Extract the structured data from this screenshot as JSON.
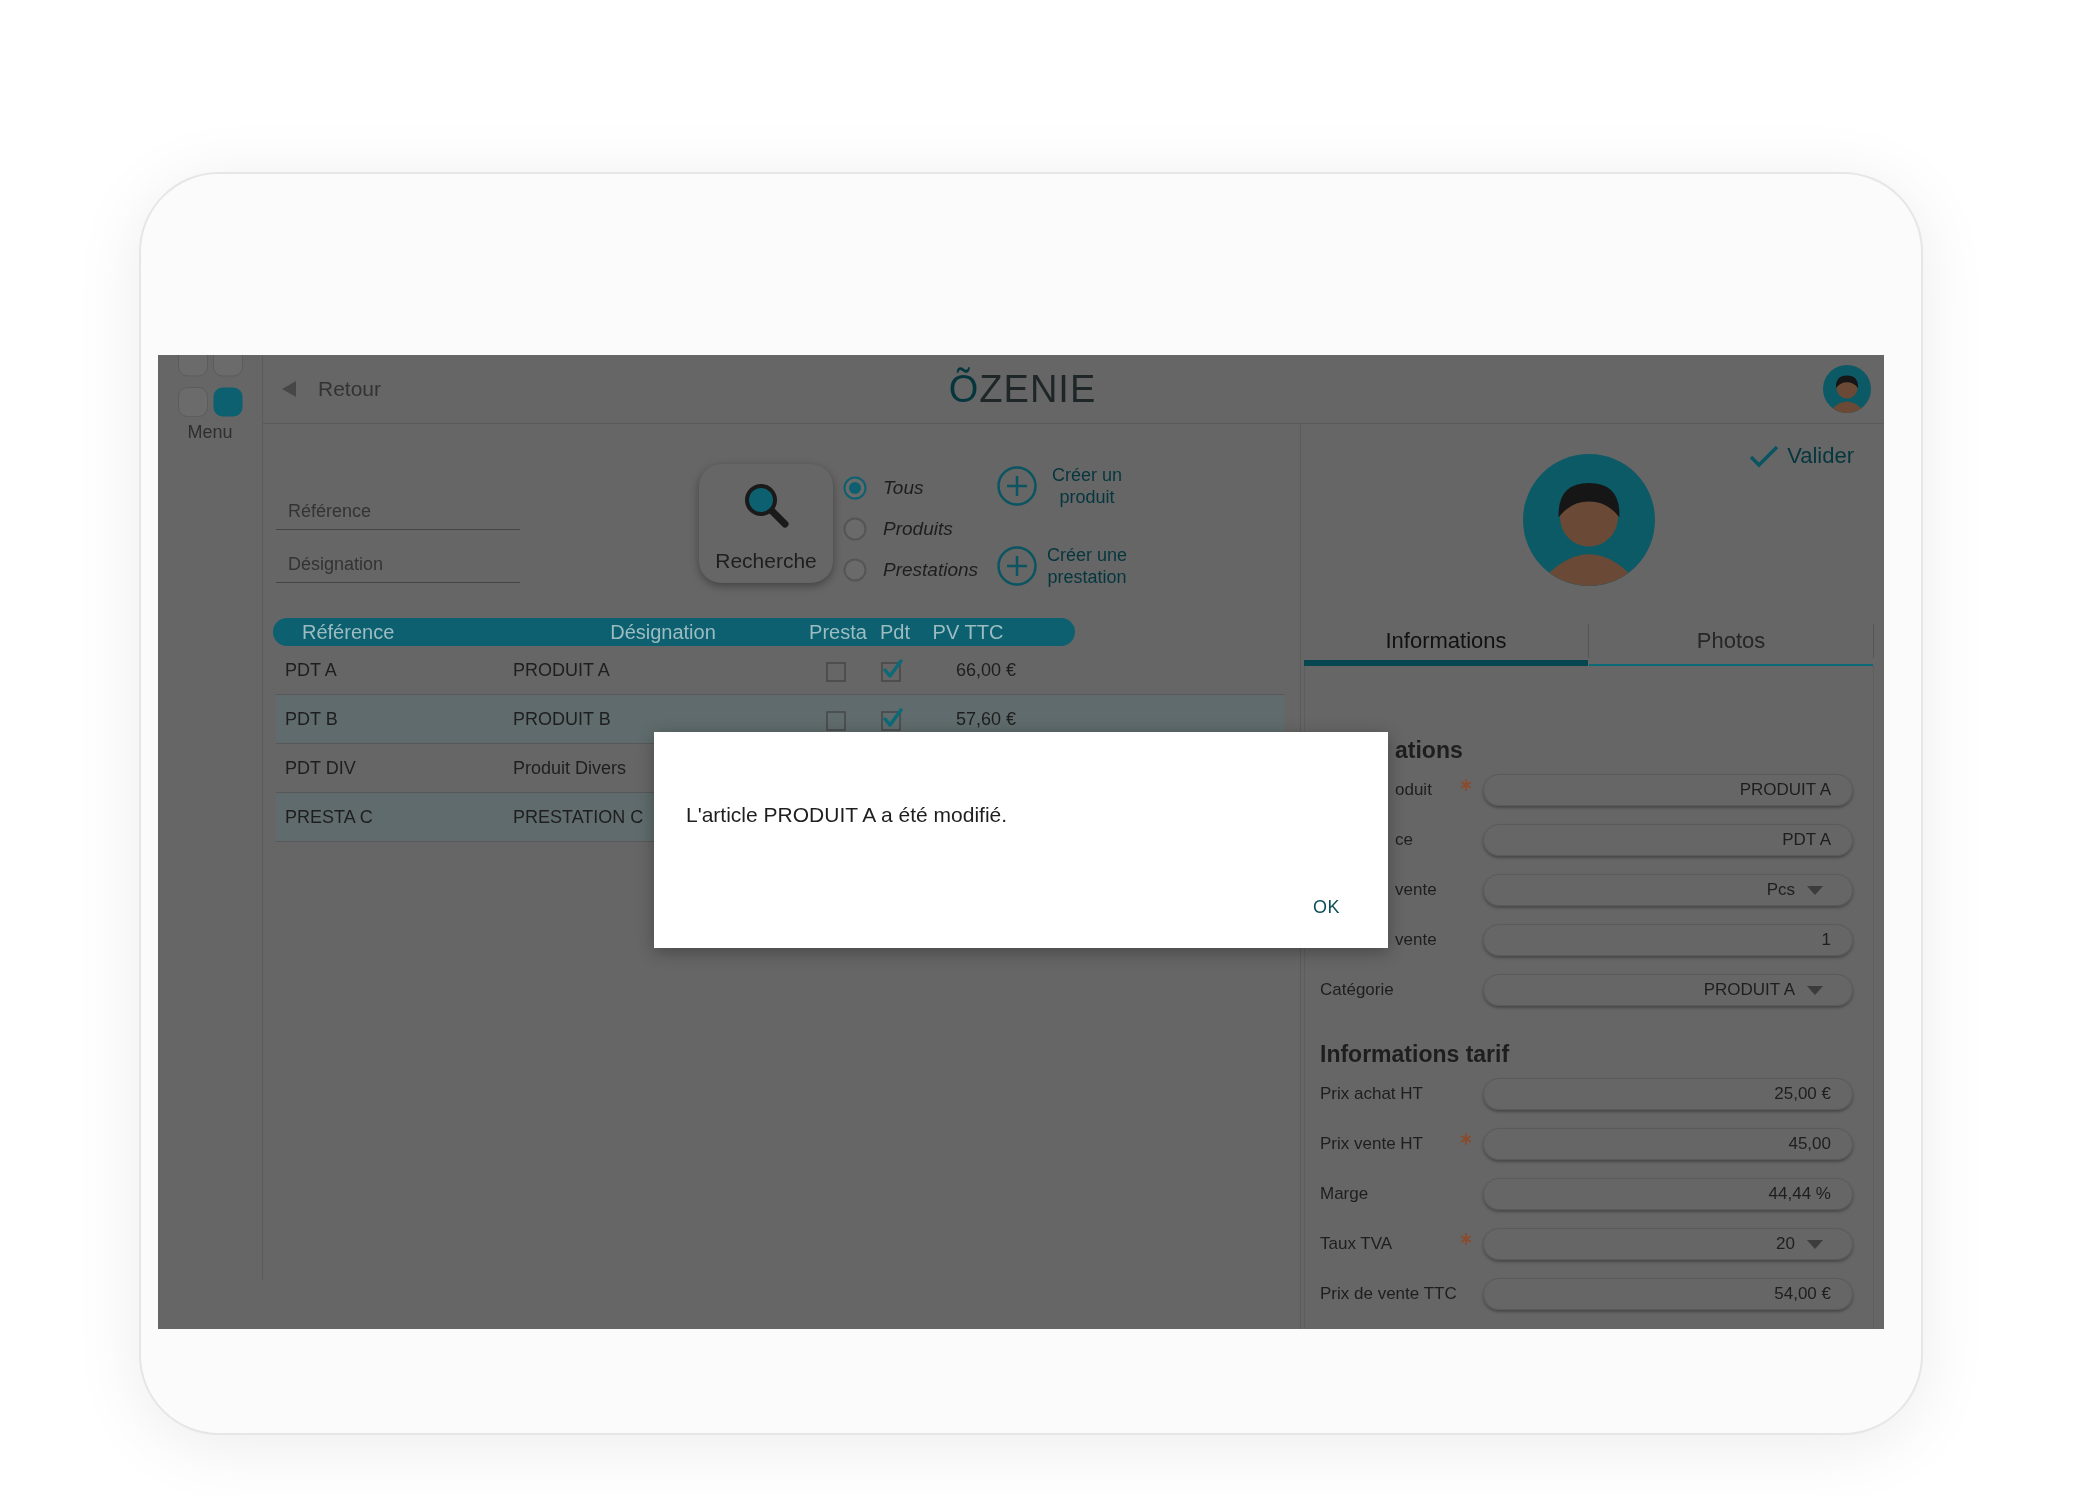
{
  "sidebar": {
    "menu": {
      "label": "Menu"
    }
  },
  "header": {
    "back": {
      "label": "Retour"
    },
    "logo": "ÕZENIE"
  },
  "search": {
    "fields": [
      {
        "placeholder": "Référence"
      },
      {
        "placeholder": "Désignation"
      }
    ],
    "button": {
      "label": "Recherche"
    },
    "filters": [
      {
        "label": "Tous",
        "selected": true
      },
      {
        "label": "Produits",
        "selected": false
      },
      {
        "label": "Prestations",
        "selected": false
      }
    ],
    "actions": [
      {
        "label": "Créer un produit"
      },
      {
        "label": "Créer une prestation"
      }
    ]
  },
  "table": {
    "columns": [
      "Référence",
      "Désignation",
      "Presta",
      "Pdt",
      "PV TTC"
    ],
    "rows": [
      {
        "reference": "PDT A",
        "designation": "PRODUIT A",
        "presta": false,
        "pdt": true,
        "pv_ttc": "66,00 €"
      },
      {
        "reference": "PDT B",
        "designation": "PRODUIT B",
        "presta": false,
        "pdt": true,
        "pv_ttc": "57,60 €"
      },
      {
        "reference": "PDT DIV",
        "designation": "Produit Divers"
      },
      {
        "reference": "PRESTA C",
        "designation": "PRESTATION C"
      }
    ]
  },
  "detail": {
    "validate": {
      "label": "Valider"
    },
    "tabs": [
      {
        "label": "Informations",
        "selected": true
      },
      {
        "label": "Photos",
        "selected": false
      }
    ],
    "sections": [
      {
        "title": "ations",
        "covered": true,
        "fields": [
          {
            "label": "oduit",
            "covered": true,
            "required": true,
            "kind": "text",
            "value": "PRODUIT A"
          },
          {
            "label": "ce",
            "covered": true,
            "required": false,
            "kind": "text",
            "value": "PDT A"
          },
          {
            "label": "vente",
            "covered": true,
            "required": false,
            "kind": "select",
            "value": "Pcs"
          },
          {
            "label": "vente",
            "covered": true,
            "required": false,
            "kind": "text",
            "value": "1"
          },
          {
            "label": "Catégorie",
            "covered": false,
            "required": false,
            "kind": "select",
            "value": "PRODUIT A"
          }
        ]
      },
      {
        "title": "Informations tarif",
        "covered": false,
        "fields": [
          {
            "label": "Prix achat HT",
            "covered": false,
            "required": false,
            "kind": "text",
            "value": "25,00 €"
          },
          {
            "label": "Prix vente HT",
            "covered": false,
            "required": true,
            "kind": "text",
            "value": "45,00"
          },
          {
            "label": "Marge",
            "covered": false,
            "required": false,
            "kind": "text",
            "value": "44,44 %"
          },
          {
            "label": "Taux TVA",
            "covered": false,
            "required": true,
            "kind": "select",
            "value": "20"
          },
          {
            "label": "Prix de vente TTC",
            "covered": false,
            "required": false,
            "kind": "text",
            "value": "54,00 €"
          }
        ]
      }
    ]
  },
  "dialog": {
    "message": "L'article PRODUIT A a été modifié.",
    "button": "OK"
  }
}
